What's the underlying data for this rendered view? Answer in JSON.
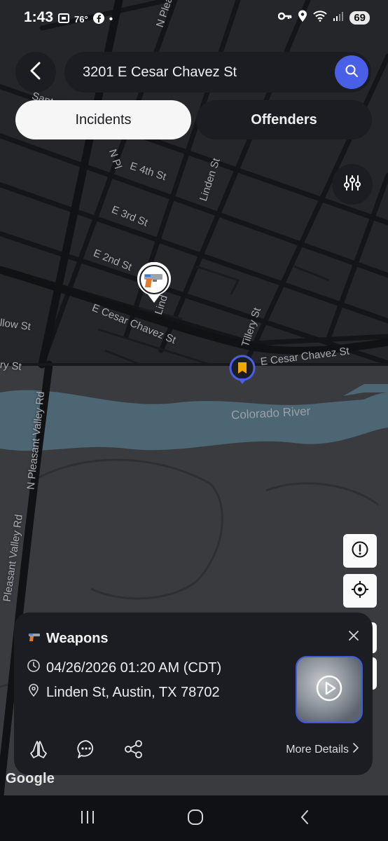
{
  "status_bar": {
    "time": "1:43",
    "temperature": "76°",
    "battery": "69"
  },
  "search": {
    "query": "3201 E Cesar Chavez St"
  },
  "segments": {
    "incidents_label": "Incidents",
    "offenders_label": "Offenders",
    "selected": "Incidents"
  },
  "map": {
    "street_labels": [
      "N Pleasant",
      "Santa R",
      "N Pl",
      "E 4th St",
      "Linden St",
      "E 3rd St",
      "E 2nd St",
      "Lind",
      "Tillery St",
      "E Cesar Chavez St",
      "E Cesar Chavez St",
      "llow St",
      "ry St",
      "N Pleasant Valley Rd",
      "Pleasant Valley Rd"
    ],
    "river_label": "Colorado River",
    "attribution": "Google"
  },
  "incident_card": {
    "category": "Weapons",
    "datetime": "04/26/2026 01:20 AM (CDT)",
    "location": "Linden St, Austin, TX 78702",
    "more_details_label": "More Details"
  },
  "colors": {
    "accent": "#4a5fe8",
    "marker_orange": "#f0a500",
    "card_bg": "#1b1d22"
  }
}
